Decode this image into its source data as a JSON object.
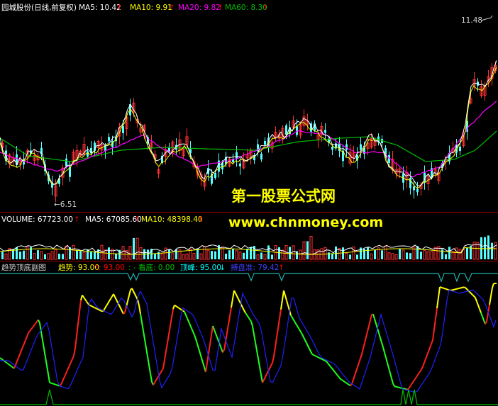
{
  "colors": {
    "background": "#000000",
    "divider": "#a00000",
    "text_white": "#ffffff",
    "ma5": "#ffffff",
    "ma10": "#ffff00",
    "ma20": "#ff00ff",
    "ma60": "#00c000",
    "candle_up": "#ff3232",
    "candle_down": "#54ffff",
    "panel_label": "#d0d0d0",
    "trend_value": "#ffff00",
    "trend_red": "#ff0000",
    "bottom_label": "#00c000",
    "top_label": "#00ffff",
    "bobao_label": "#4040ff",
    "watermark": "#ffff00",
    "arrow_red": "#ff0000",
    "trend_blue": "#2020ff",
    "flag_line": "#20b0b0"
  },
  "price_panel": {
    "stock_title": "园城股份(日线,前复权)",
    "ma5_label": "MA5: 10.42",
    "ma10_label": "MA10: 9.91",
    "ma20_label": "MA20: 9.82",
    "ma60_label": "MA60: 8.30",
    "high_label": "11.48",
    "low_label": "←6.51"
  },
  "volume_panel": {
    "volume_label": "VOLUME: 67723.00",
    "ma5_label": "MA5: 67085.60",
    "ma10_label": "MA10: 48398.40"
  },
  "indicator_panel": {
    "name": "趋势顶底副图",
    "trend_label": "趋势: 93.00",
    "trend_value2": ": 93.00",
    "bottom_label": ": - 看底: 0.00",
    "top_label": "顶峰: 95.00",
    "bobao_label": "搏盘准: 79.42"
  },
  "watermark": {
    "line1": "第一股票公式网",
    "line2": "www.chnmoney.com"
  }
}
